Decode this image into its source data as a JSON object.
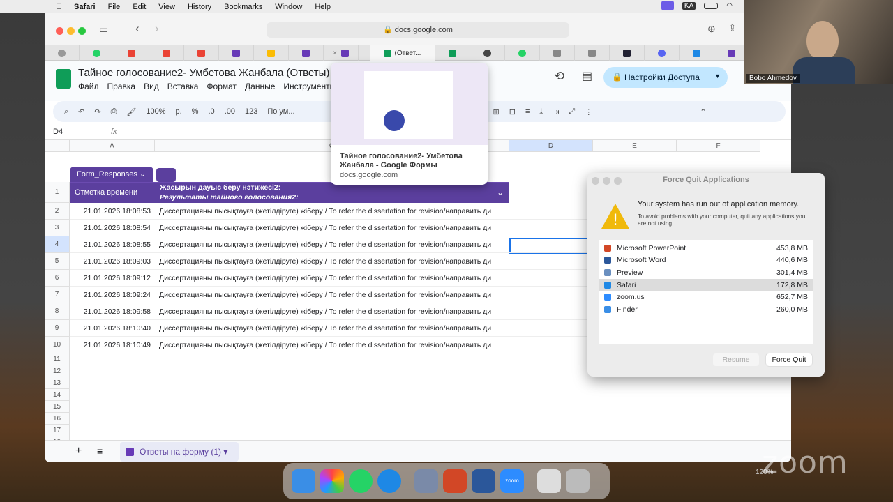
{
  "menubar": {
    "app": "Safari",
    "items": [
      "File",
      "Edit",
      "View",
      "History",
      "Bookmarks",
      "Window",
      "Help"
    ],
    "kb": "KA"
  },
  "browser": {
    "url": "docs.google.com",
    "active_tab": "(Ответ..."
  },
  "sheet": {
    "title": "Тайное голосование2- Умбетова Жанбала (Ответы)",
    "menus": [
      "Файл",
      "Правка",
      "Вид",
      "Вставка",
      "Формат",
      "Данные",
      "Инструменты"
    ],
    "share": "Настройки Доступа",
    "zoom": "100%",
    "currency": "р.",
    "percent": "%",
    "dec_minus": ".0",
    "dec_plus": ".00",
    "num": "123",
    "font": "По ум...",
    "cell_ref": "D4",
    "fx": "fx",
    "cols": [
      "A",
      "C",
      "D",
      "E",
      "F"
    ],
    "table_name": "Form_Responses",
    "header_a": "Отметка времени",
    "header_b1": "Жасырын дауыс беру нәтижесі2:",
    "header_b2": "Результаты тайного голосования2:",
    "rows": [
      {
        "n": "2",
        "ts": "21.01.2026 18:08:53"
      },
      {
        "n": "3",
        "ts": "21.01.2026 18:08:54"
      },
      {
        "n": "4",
        "ts": "21.01.2026 18:08:55"
      },
      {
        "n": "5",
        "ts": "21.01.2026 18:09:03"
      },
      {
        "n": "6",
        "ts": "21.01.2026 18:09:12"
      },
      {
        "n": "7",
        "ts": "21.01.2026 18:09:24"
      },
      {
        "n": "8",
        "ts": "21.01.2026 18:09:58"
      },
      {
        "n": "9",
        "ts": "21.01.2026 18:10:40"
      },
      {
        "n": "10",
        "ts": "21.01.2026 18:10:49"
      }
    ],
    "answer": "Диссертацияны пысықтауға (жетілдіруге) жіберу / To refer the dissertation for revision/направить  ди",
    "empty_rows": [
      "11",
      "12",
      "13",
      "14",
      "15",
      "16",
      "17",
      "18"
    ],
    "sheet_tab": "Ответы на форму (1)",
    "row1": "1"
  },
  "popup": {
    "title": "Тайное голосование2- Умбетова Жанбала - Google Формы",
    "domain": "docs.google.com"
  },
  "force_quit": {
    "title": "Force Quit Applications",
    "heading": "Your system has run out of application memory.",
    "sub": "To avoid problems with your computer, quit any applications you are not using.",
    "apps": [
      {
        "name": "Microsoft PowerPoint",
        "mem": "453,8 MB",
        "color": "#d24726"
      },
      {
        "name": "Microsoft Word",
        "mem": "440,6 MB",
        "color": "#2b579a"
      },
      {
        "name": "Preview",
        "mem": "301,4 MB",
        "color": "#6a8fbf"
      },
      {
        "name": "Safari",
        "mem": "172,8 MB",
        "color": "#1e88e5"
      },
      {
        "name": "zoom.us",
        "mem": "652,7 MB",
        "color": "#2d8cff"
      },
      {
        "name": "Finder",
        "mem": "260,0 MB",
        "color": "#3a8ee6"
      }
    ],
    "resume": "Resume",
    "force": "Force Quit"
  },
  "video": {
    "name": "Bobo Ahmedov"
  },
  "zoom_brand": "zoom",
  "zoom_level": "120%"
}
